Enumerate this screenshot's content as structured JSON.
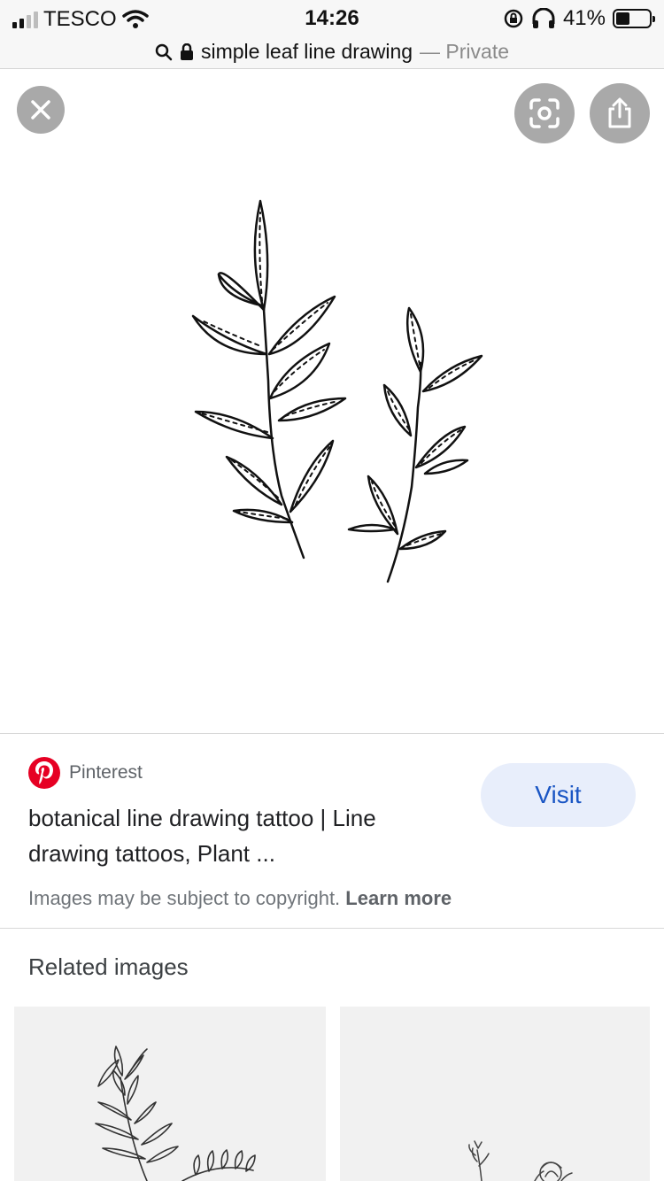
{
  "status_bar": {
    "carrier": "TESCO",
    "time": "14:26",
    "battery": "41%",
    "battery_level": 0.41
  },
  "url_bar": {
    "query": "simple leaf line drawing",
    "private_label": "— Private"
  },
  "buttons": {
    "close_icon": "close-icon",
    "lens_icon": "lens-icon",
    "share_icon": "share-icon"
  },
  "result": {
    "source": "Pinterest",
    "title": "botanical line drawing tattoo | Line drawing tattoos, Plant ...",
    "visit_label": "Visit",
    "copyright_text": "Images may be subject to copyright.",
    "learn_more": "Learn more"
  },
  "related": {
    "title": "Related images"
  },
  "colors": {
    "accent": "#1a56c4",
    "visit_bg": "#e8eefb",
    "pinterest": "#e60023"
  }
}
